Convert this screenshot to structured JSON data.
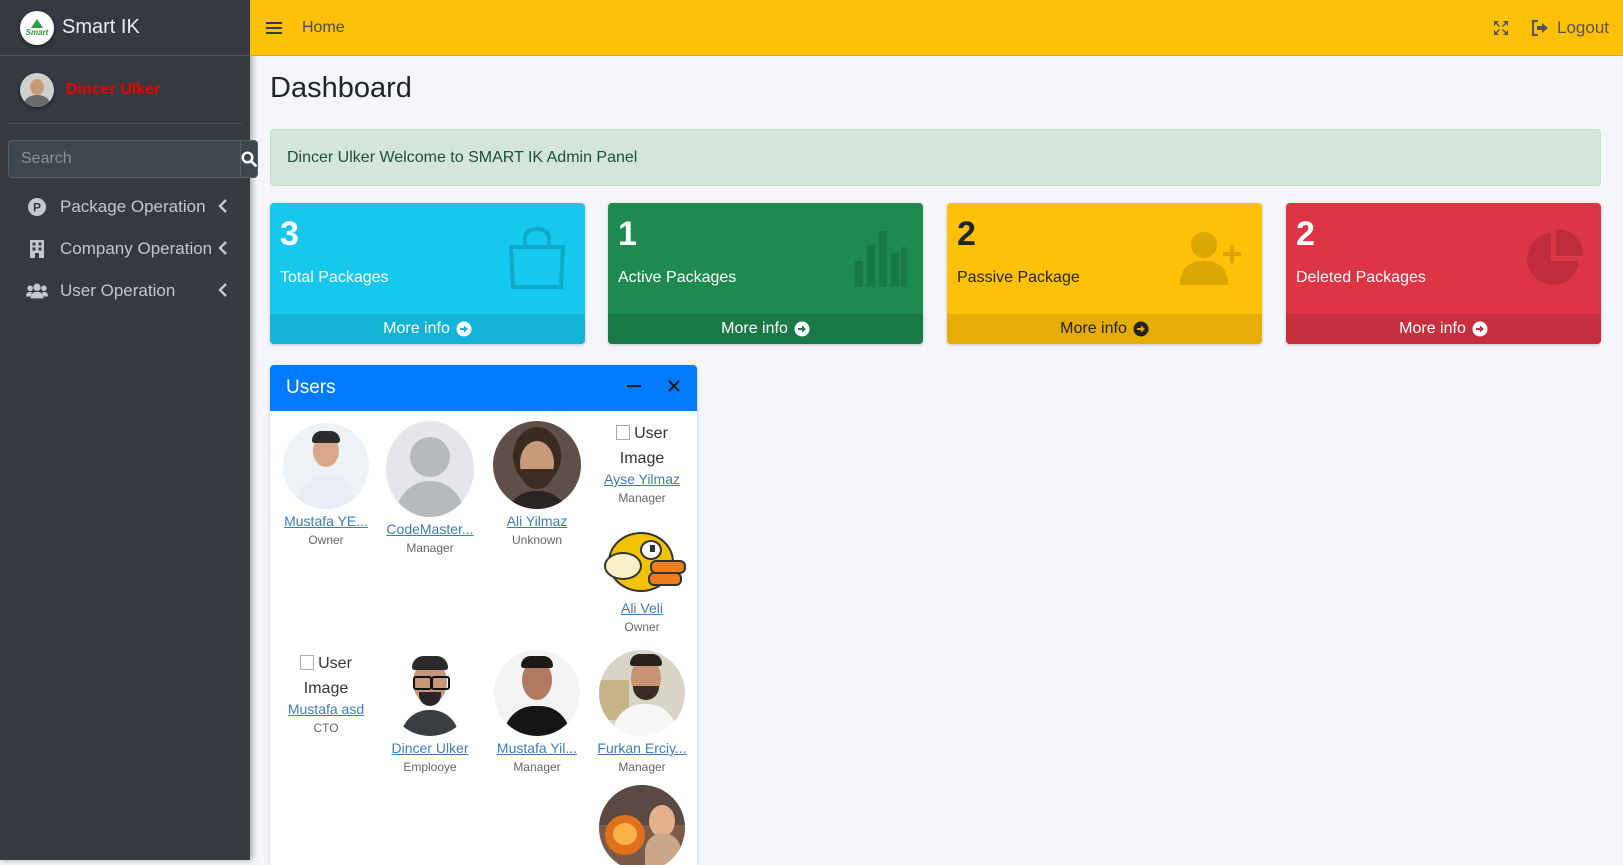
{
  "brand": {
    "logo_text": "Smart",
    "title": "Smart IK"
  },
  "sidebar": {
    "user_name": "Dincer Ulker",
    "search_placeholder": "Search",
    "items": [
      {
        "label": "Package Operation",
        "icon": "parking-p-icon"
      },
      {
        "label": "Company Operation",
        "icon": "building-icon"
      },
      {
        "label": "User Operation",
        "icon": "users-icon"
      }
    ]
  },
  "topbar": {
    "home": "Home",
    "logout": "Logout"
  },
  "page": {
    "title": "Dashboard",
    "welcome": "Dincer Ulker Welcome to SMART IK Admin Panel"
  },
  "stats": [
    {
      "value": "3",
      "label": "Total Packages",
      "more": "More info",
      "color": "#17c8ed",
      "icon": "shopping-bag-icon"
    },
    {
      "value": "1",
      "label": "Active Packages",
      "more": "More info",
      "color": "#1e8a50",
      "icon": "bar-chart-icon"
    },
    {
      "value": "2",
      "label": "Passive Package",
      "more": "More info",
      "color": "#ffc107",
      "icon": "user-plus-icon"
    },
    {
      "value": "2",
      "label": "Deleted Packages",
      "more": "More info",
      "color": "#dc3545",
      "icon": "pie-chart-icon"
    }
  ],
  "users_card": {
    "title": "Users",
    "broken_image_alt": "User Image",
    "users": [
      {
        "name": "Mustafa YE...",
        "role": "Owner"
      },
      {
        "name": "CodeMaster...",
        "role": "Manager"
      },
      {
        "name": "Ali Yilmaz",
        "role": "Unknown"
      },
      {
        "name": "Ayse Yilmaz",
        "role": "Manager"
      },
      {
        "name": "Ali Veli",
        "role": "Owner"
      },
      {
        "name": "Mustafa asd",
        "role": "CTO"
      },
      {
        "name": "Dincer Ulker",
        "role": "Emplooye"
      },
      {
        "name": "Mustafa Yil...",
        "role": "Manager"
      },
      {
        "name": "Furkan Erciy...",
        "role": "Manager"
      }
    ]
  }
}
